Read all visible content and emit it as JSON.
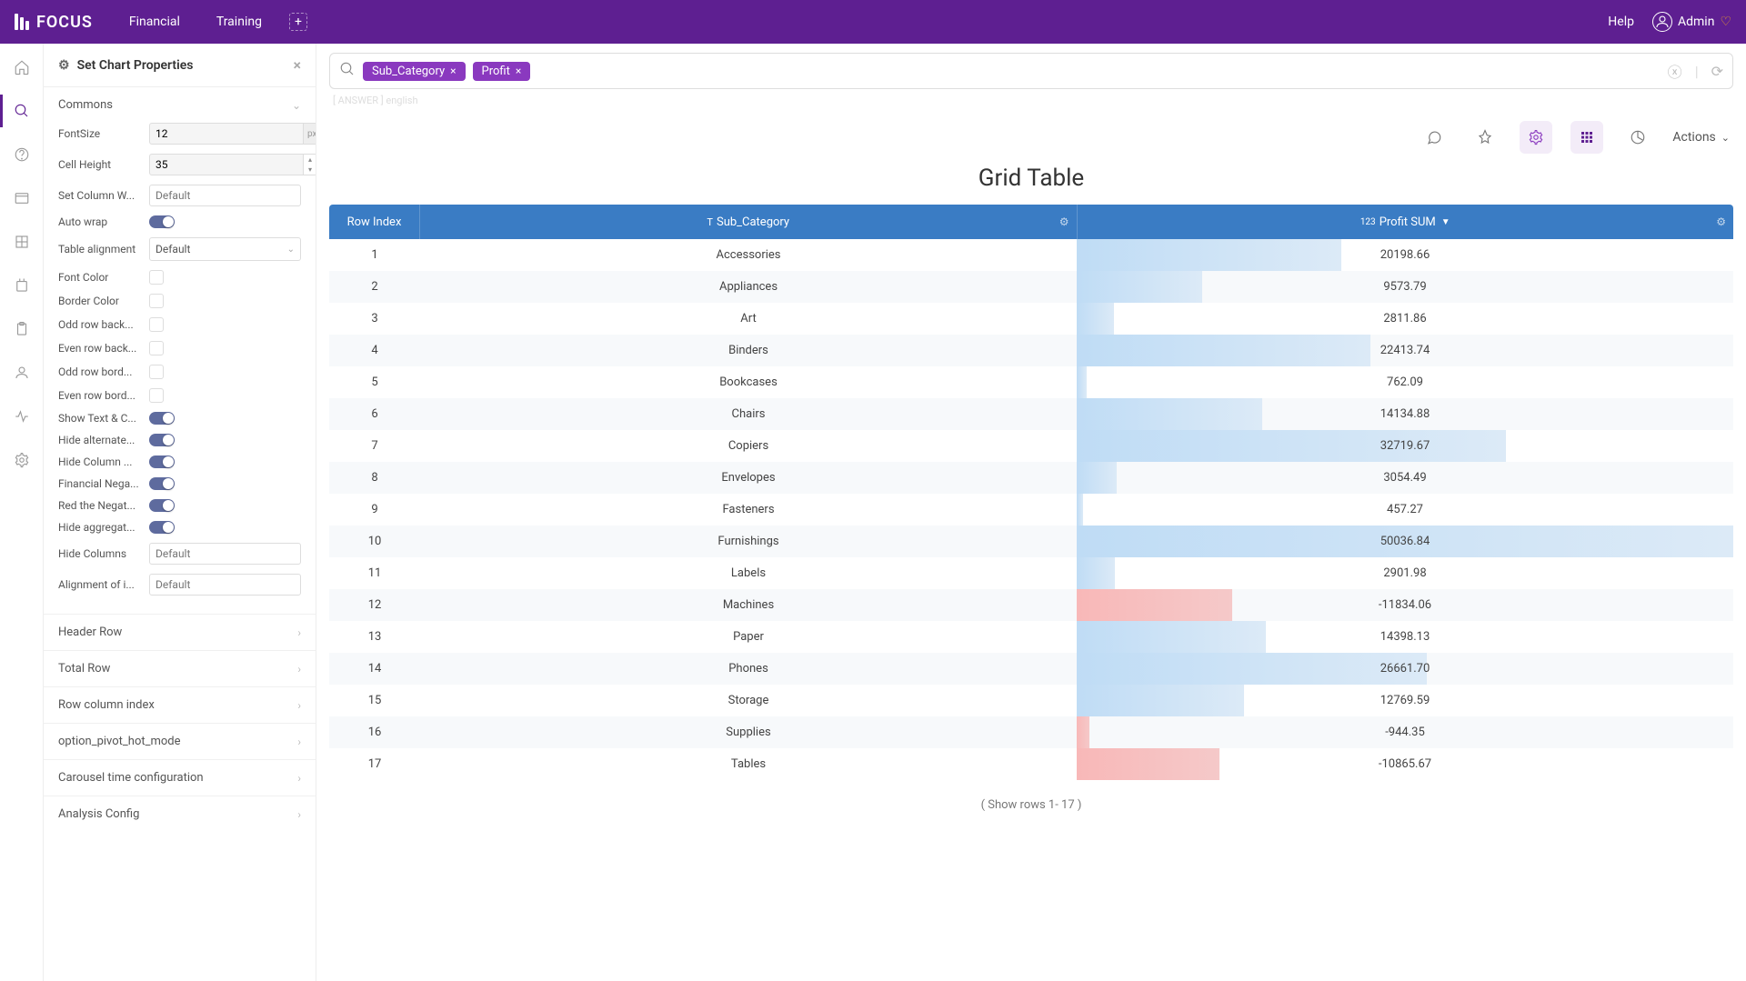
{
  "brand": "FOCUS",
  "nav": {
    "items": [
      "Financial",
      "Training"
    ]
  },
  "topbar": {
    "help": "Help",
    "user": "Admin"
  },
  "panel": {
    "title": "Set Chart Properties",
    "commons_label": "Commons",
    "props": {
      "font_size_label": "FontSize",
      "font_size_value": "12",
      "font_size_unit": "px",
      "cell_height_label": "Cell Height",
      "cell_height_value": "35",
      "set_col_width_label": "Set Column W...",
      "set_col_width_placeholder": "Default",
      "auto_wrap_label": "Auto wrap",
      "table_align_label": "Table alignment",
      "table_align_value": "Default",
      "font_color_label": "Font Color",
      "border_color_label": "Border Color",
      "odd_row_back_label": "Odd row back...",
      "even_row_back_label": "Even row back...",
      "odd_row_bord_label": "Odd row bord...",
      "even_row_bord_label": "Even row bord...",
      "show_text_label": "Show Text & C...",
      "hide_alternate_label": "Hide alternate...",
      "hide_column_label": "Hide Column ...",
      "financial_nega_label": "Financial Nega...",
      "red_negat_label": "Red the Negat...",
      "hide_aggregat_label": "Hide aggregat...",
      "hide_columns_label": "Hide Columns",
      "hide_columns_placeholder": "Default",
      "align_index_label": "Alignment of i...",
      "align_index_placeholder": "Default"
    },
    "other_sections": [
      "Header Row",
      "Total Row",
      "Row column index",
      "option_pivot_hot_mode",
      "Carousel time configuration",
      "Analysis Config"
    ]
  },
  "search": {
    "chips": [
      "Sub_Category",
      "Profit"
    ]
  },
  "meta": {
    "answer_label": "[ ANSWER ]",
    "lang": "english"
  },
  "actions_label": "Actions",
  "chart_title": "Grid Table",
  "table": {
    "headers": {
      "idx": "Row Index",
      "cat": "Sub_Category",
      "val": "Profit SUM"
    },
    "show_rows": "( Show rows 1- 17 )"
  },
  "chart_data": {
    "type": "table",
    "title": "Grid Table",
    "columns": [
      "Row Index",
      "Sub_Category",
      "Profit SUM"
    ],
    "rows": [
      {
        "idx": 1,
        "cat": "Accessories",
        "val": 20198.66
      },
      {
        "idx": 2,
        "cat": "Appliances",
        "val": 9573.79
      },
      {
        "idx": 3,
        "cat": "Art",
        "val": 2811.86
      },
      {
        "idx": 4,
        "cat": "Binders",
        "val": 22413.74
      },
      {
        "idx": 5,
        "cat": "Bookcases",
        "val": 762.09
      },
      {
        "idx": 6,
        "cat": "Chairs",
        "val": 14134.88
      },
      {
        "idx": 7,
        "cat": "Copiers",
        "val": 32719.67
      },
      {
        "idx": 8,
        "cat": "Envelopes",
        "val": 3054.49
      },
      {
        "idx": 9,
        "cat": "Fasteners",
        "val": 457.27
      },
      {
        "idx": 10,
        "cat": "Furnishings",
        "val": 50036.84
      },
      {
        "idx": 11,
        "cat": "Labels",
        "val": 2901.98
      },
      {
        "idx": 12,
        "cat": "Machines",
        "val": -11834.06
      },
      {
        "idx": 13,
        "cat": "Paper",
        "val": 14398.13
      },
      {
        "idx": 14,
        "cat": "Phones",
        "val": 26661.7
      },
      {
        "idx": 15,
        "cat": "Storage",
        "val": 12769.59
      },
      {
        "idx": 16,
        "cat": "Supplies",
        "val": -944.35
      },
      {
        "idx": 17,
        "cat": "Tables",
        "val": -10865.67
      }
    ],
    "max_abs": 50036.84
  }
}
